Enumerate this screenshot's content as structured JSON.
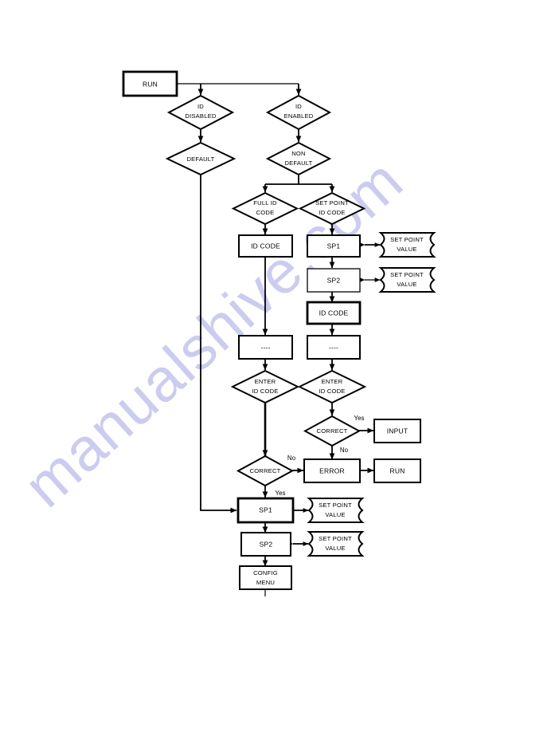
{
  "page": {
    "title": "ID Code Access Flowchart",
    "background_color": "#ffffff",
    "line_color": "#000000"
  },
  "watermark": {
    "text": "manualshive.com",
    "color": "#ccccf0",
    "rotation_degrees": -42
  },
  "nodes": {
    "run_top": {
      "label": "RUN",
      "shape": "process"
    },
    "id_disabled": {
      "label_line1": "ID",
      "label_line2": "DISABLED",
      "shape": "decision"
    },
    "id_enabled": {
      "label_line1": "ID",
      "label_line2": "ENABLED",
      "shape": "decision"
    },
    "default": {
      "label": "DEFAULT",
      "shape": "decision"
    },
    "non_default": {
      "label_line1": "NON",
      "label_line2": "DEFAULT",
      "shape": "decision"
    },
    "full_id_code": {
      "label_line1": "FULL ID",
      "label_line2": "CODE",
      "shape": "decision"
    },
    "set_point_id_code": {
      "label_line1": "SET POINT",
      "label_line2": "ID CODE",
      "shape": "decision"
    },
    "id_code_left": {
      "label": "ID CODE",
      "shape": "process"
    },
    "sp1_right": {
      "label": "SP1",
      "shape": "process"
    },
    "spv_sp1_right": {
      "label_line1": "SET POINT",
      "label_line2": "VALUE",
      "shape": "tape"
    },
    "sp2_right": {
      "label": "SP2",
      "shape": "process"
    },
    "spv_sp2_right": {
      "label_line1": "SET POINT",
      "label_line2": "VALUE",
      "shape": "tape"
    },
    "id_code_right": {
      "label": "ID CODE",
      "shape": "process"
    },
    "dashes_left": {
      "label": "----",
      "shape": "process"
    },
    "dashes_right": {
      "label": "----",
      "shape": "process"
    },
    "enter_id_code_left": {
      "label_line1": "ENTER",
      "label_line2": "ID CODE",
      "shape": "decision"
    },
    "enter_id_code_right": {
      "label_line1": "ENTER",
      "label_line2": "ID CODE",
      "shape": "decision"
    },
    "correct_right": {
      "label": "CORRECT",
      "shape": "decision"
    },
    "input": {
      "label": "INPUT",
      "shape": "process"
    },
    "correct_left": {
      "label": "CORRECT",
      "shape": "decision"
    },
    "error": {
      "label": "ERROR",
      "shape": "process"
    },
    "run_bottom": {
      "label": "RUN",
      "shape": "process"
    },
    "sp1_bottom": {
      "label": "SP1",
      "shape": "process"
    },
    "spv_sp1_bottom": {
      "label_line1": "SET POINT",
      "label_line2": "VALUE",
      "shape": "tape"
    },
    "sp2_bottom": {
      "label": "SP2",
      "shape": "process"
    },
    "spv_sp2_bottom": {
      "label_line1": "SET POINT",
      "label_line2": "VALUE",
      "shape": "tape"
    },
    "config_menu": {
      "label_line1": "CONFIG",
      "label_line2": "MENU",
      "shape": "process"
    }
  },
  "edge_labels": {
    "correct_right_yes": "Yes",
    "correct_right_no": "No",
    "correct_left_no": "No",
    "correct_left_yes": "Yes"
  }
}
